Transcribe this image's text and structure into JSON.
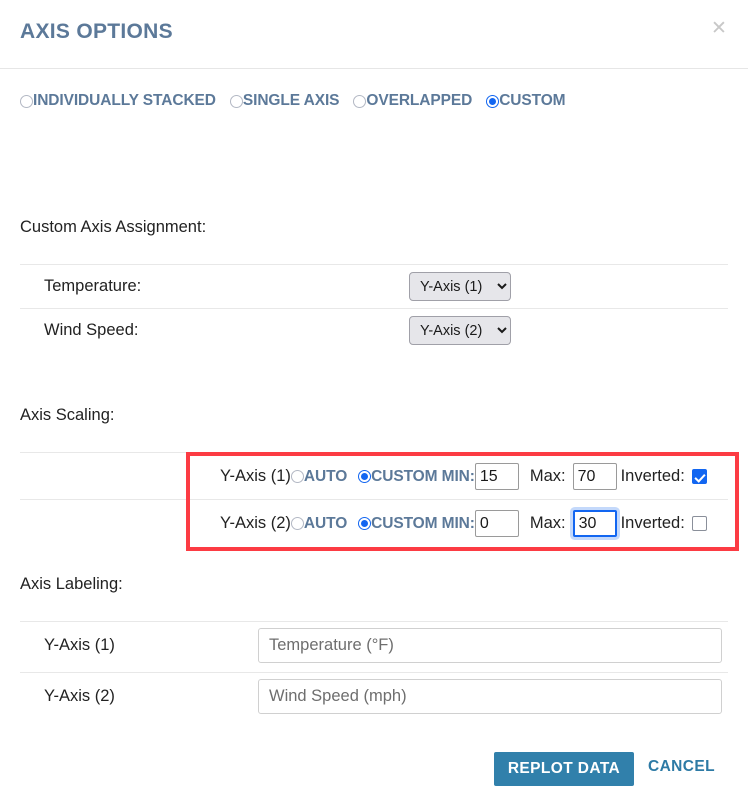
{
  "dialog": {
    "title": "AXIS OPTIONS",
    "close_icon": "close-icon"
  },
  "mode_options": [
    {
      "label": "INDIVIDUALLY STACKED",
      "selected": false
    },
    {
      "label": "SINGLE AXIS",
      "selected": false
    },
    {
      "label": "OVERLAPPED",
      "selected": false
    },
    {
      "label": "CUSTOM",
      "selected": true
    }
  ],
  "sections": {
    "assignment_title": "Custom Axis Assignment:",
    "scaling_title": "Axis Scaling:",
    "labeling_title": "Axis Labeling:"
  },
  "assignment_rows": [
    {
      "label": "Temperature:",
      "value": "Y-Axis (1)"
    },
    {
      "label": "Wind Speed:",
      "value": "Y-Axis (2)"
    }
  ],
  "axis_select_options": [
    "Y-Axis (1)",
    "Y-Axis (2)"
  ],
  "scaling": {
    "auto_label": "AUTO",
    "custom_min_label": "CUSTOM MIN:",
    "max_label": "Max:",
    "inverted_label": "Inverted:",
    "rows": [
      {
        "axis": "Y-Axis (1)",
        "auto_selected": false,
        "custom_selected": true,
        "min": "15",
        "max": "70",
        "inverted": true,
        "max_focused": false
      },
      {
        "axis": "Y-Axis (2)",
        "auto_selected": false,
        "custom_selected": true,
        "min": "0",
        "max": "30",
        "inverted": false,
        "max_focused": true
      }
    ]
  },
  "labeling_rows": [
    {
      "label": "Y-Axis (1)",
      "value": "",
      "placeholder": "Temperature (°F)"
    },
    {
      "label": "Y-Axis (2)",
      "value": "",
      "placeholder": "Wind Speed (mph)"
    }
  ],
  "footer": {
    "replot_label": "REPLOT DATA",
    "cancel_label": "CANCEL"
  },
  "colors": {
    "accent_blue": "#1266f1",
    "title_slate": "#5c7999",
    "primary_button": "#3180ab",
    "link_blue": "#2d7aa5",
    "highlight_red": "#fc3b43"
  }
}
